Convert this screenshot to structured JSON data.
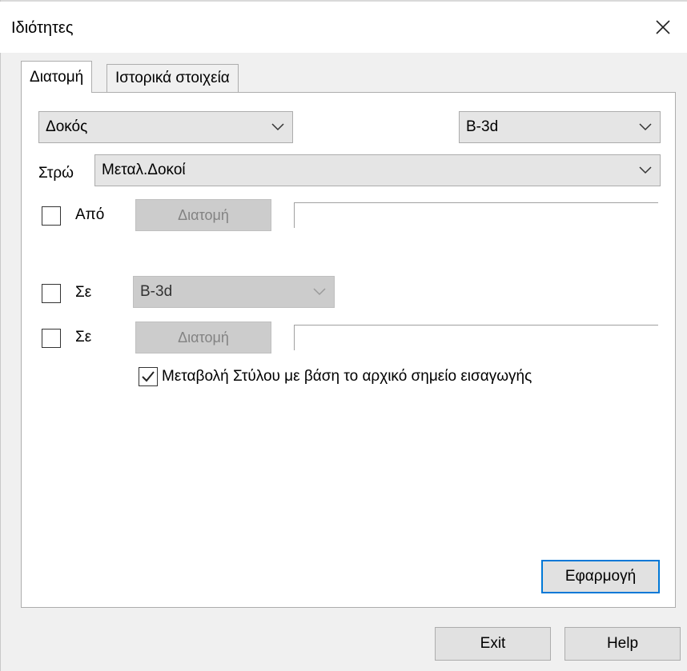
{
  "window": {
    "title": "Ιδιότητες"
  },
  "tabs": [
    {
      "label": "Διατομή",
      "active": true
    },
    {
      "label": "Ιστορικά στοιχεία",
      "active": false
    }
  ],
  "form": {
    "type_select": {
      "value": "Δοκός"
    },
    "section_select": {
      "value": "B-3d"
    },
    "layer_label": "Στρώ",
    "layer_select": {
      "value": "Μεταλ.Δοκοί"
    },
    "from": {
      "label": "Από",
      "checked": false,
      "button_label": "Διατομή",
      "value": ""
    },
    "to_combo": {
      "label": "Σε",
      "checked": false,
      "value": "B-3d"
    },
    "to_section": {
      "label": "Σε",
      "checked": false,
      "button_label": "Διατομή",
      "value": ""
    },
    "style_change": {
      "label": "Μεταβολή Στύλου με βάση το αρχικό σημείο εισαγωγής",
      "checked": true
    }
  },
  "buttons": {
    "apply": "Εφαρμογή",
    "exit": "Exit",
    "help": "Help"
  },
  "colors": {
    "accent": "#0078d7",
    "panel": "#ffffff",
    "dialog": "#f0f0f0"
  }
}
